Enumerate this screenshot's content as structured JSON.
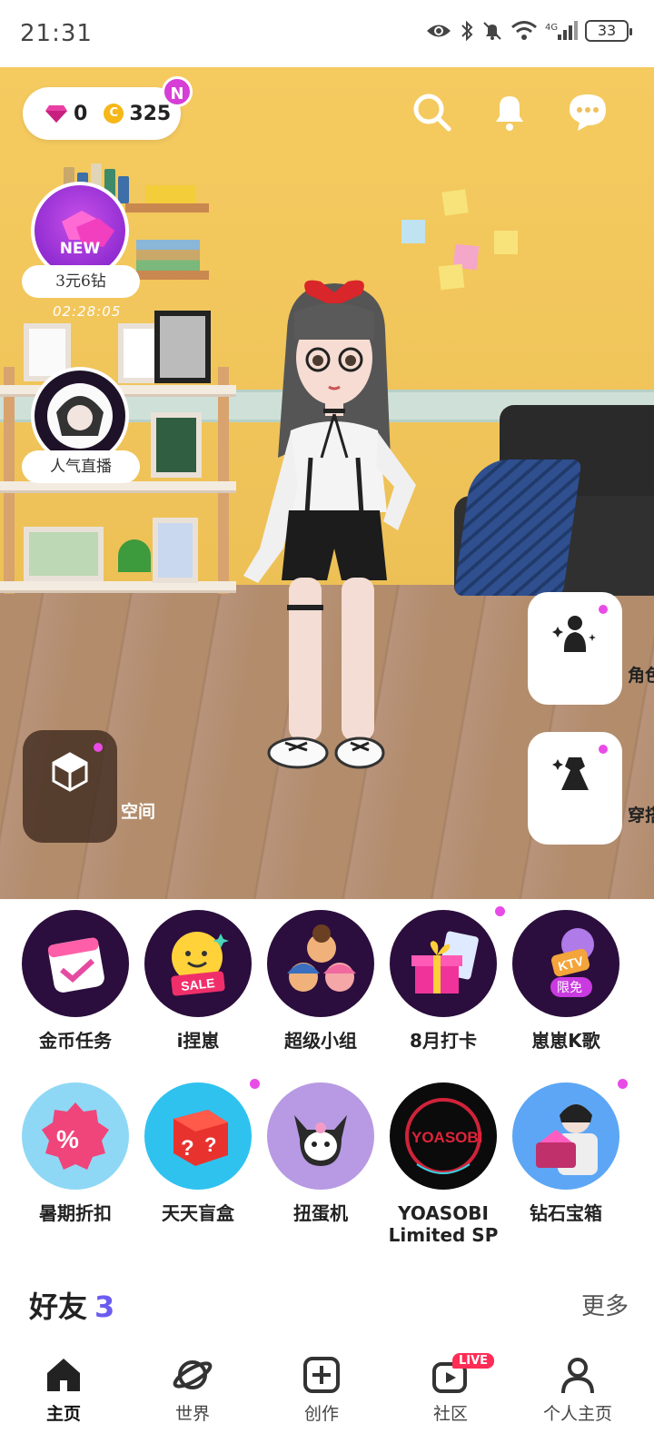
{
  "status_bar": {
    "time": "21:31",
    "battery": "33",
    "network": "4G"
  },
  "currency": {
    "diamonds": "0",
    "coins": "325",
    "coin_symbol": "C",
    "badge": "N"
  },
  "floating": {
    "event_new_badge": "NEW",
    "event_label": "3元6钻",
    "event_timer": "02:28:05",
    "live_label": "人气直播"
  },
  "side_buttons": {
    "space": "空间",
    "character": "角色",
    "outfit": "穿搭"
  },
  "features": [
    {
      "label": "金币任务",
      "dot": false
    },
    {
      "label": "i捏崽",
      "dot": false,
      "tag": "SALE"
    },
    {
      "label": "超级小组",
      "dot": false
    },
    {
      "label": "8月打卡",
      "dot": true
    },
    {
      "label": "崽崽K歌",
      "dot": false,
      "tag": "KTV",
      "tag2": "限免"
    },
    {
      "label": "暑期折扣",
      "dot": false
    },
    {
      "label": "天天盲盒",
      "dot": true
    },
    {
      "label": "扭蛋机",
      "dot": false
    },
    {
      "label": "YOASOBI\nLimited SP",
      "dot": false,
      "tag": "YOASOBI"
    },
    {
      "label": "钻石宝箱",
      "dot": true
    }
  ],
  "friends": {
    "title": "好友",
    "count": "3",
    "more": "更多"
  },
  "tabs": [
    {
      "label": "主页",
      "active": true
    },
    {
      "label": "世界",
      "active": false
    },
    {
      "label": "创作",
      "active": false
    },
    {
      "label": "社区",
      "active": false,
      "badge": "LIVE"
    },
    {
      "label": "个人主页",
      "active": false
    }
  ],
  "colors": {
    "accent_purple": "#6b5cf0",
    "notify_pink": "#e84be6",
    "live_red": "#ff2d55",
    "wall_yellow": "#f5cb60"
  }
}
